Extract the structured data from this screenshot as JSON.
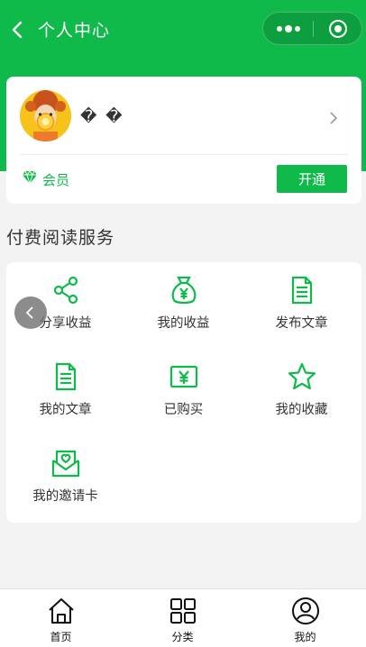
{
  "nav": {
    "title": "个人中心",
    "back_icon": "chevron-left-icon",
    "more_icon": "more-dots-icon",
    "close_icon": "target-icon"
  },
  "colors": {
    "brand": "#0fba4a",
    "background": "#f3f3f3"
  },
  "profile": {
    "name": "� �",
    "member_label": "会员",
    "open_button": "开通",
    "avatar_icon": "avatar-image",
    "vip_icon": "diamond-icon"
  },
  "section": {
    "title": "付费阅读服务"
  },
  "services": [
    {
      "label": "分享收益",
      "icon": "share-icon"
    },
    {
      "label": "我的收益",
      "icon": "money-bag-icon"
    },
    {
      "label": "发布文章",
      "icon": "document-icon"
    },
    {
      "label": "我的文章",
      "icon": "document-icon"
    },
    {
      "label": "已购买",
      "icon": "yen-card-icon"
    },
    {
      "label": "我的收藏",
      "icon": "star-icon"
    },
    {
      "label": "我的邀请卡",
      "icon": "envelope-heart-icon"
    }
  ],
  "tabbar": [
    {
      "label": "首页",
      "icon": "home-icon"
    },
    {
      "label": "分类",
      "icon": "grid-icon"
    },
    {
      "label": "我的",
      "icon": "user-icon"
    }
  ]
}
